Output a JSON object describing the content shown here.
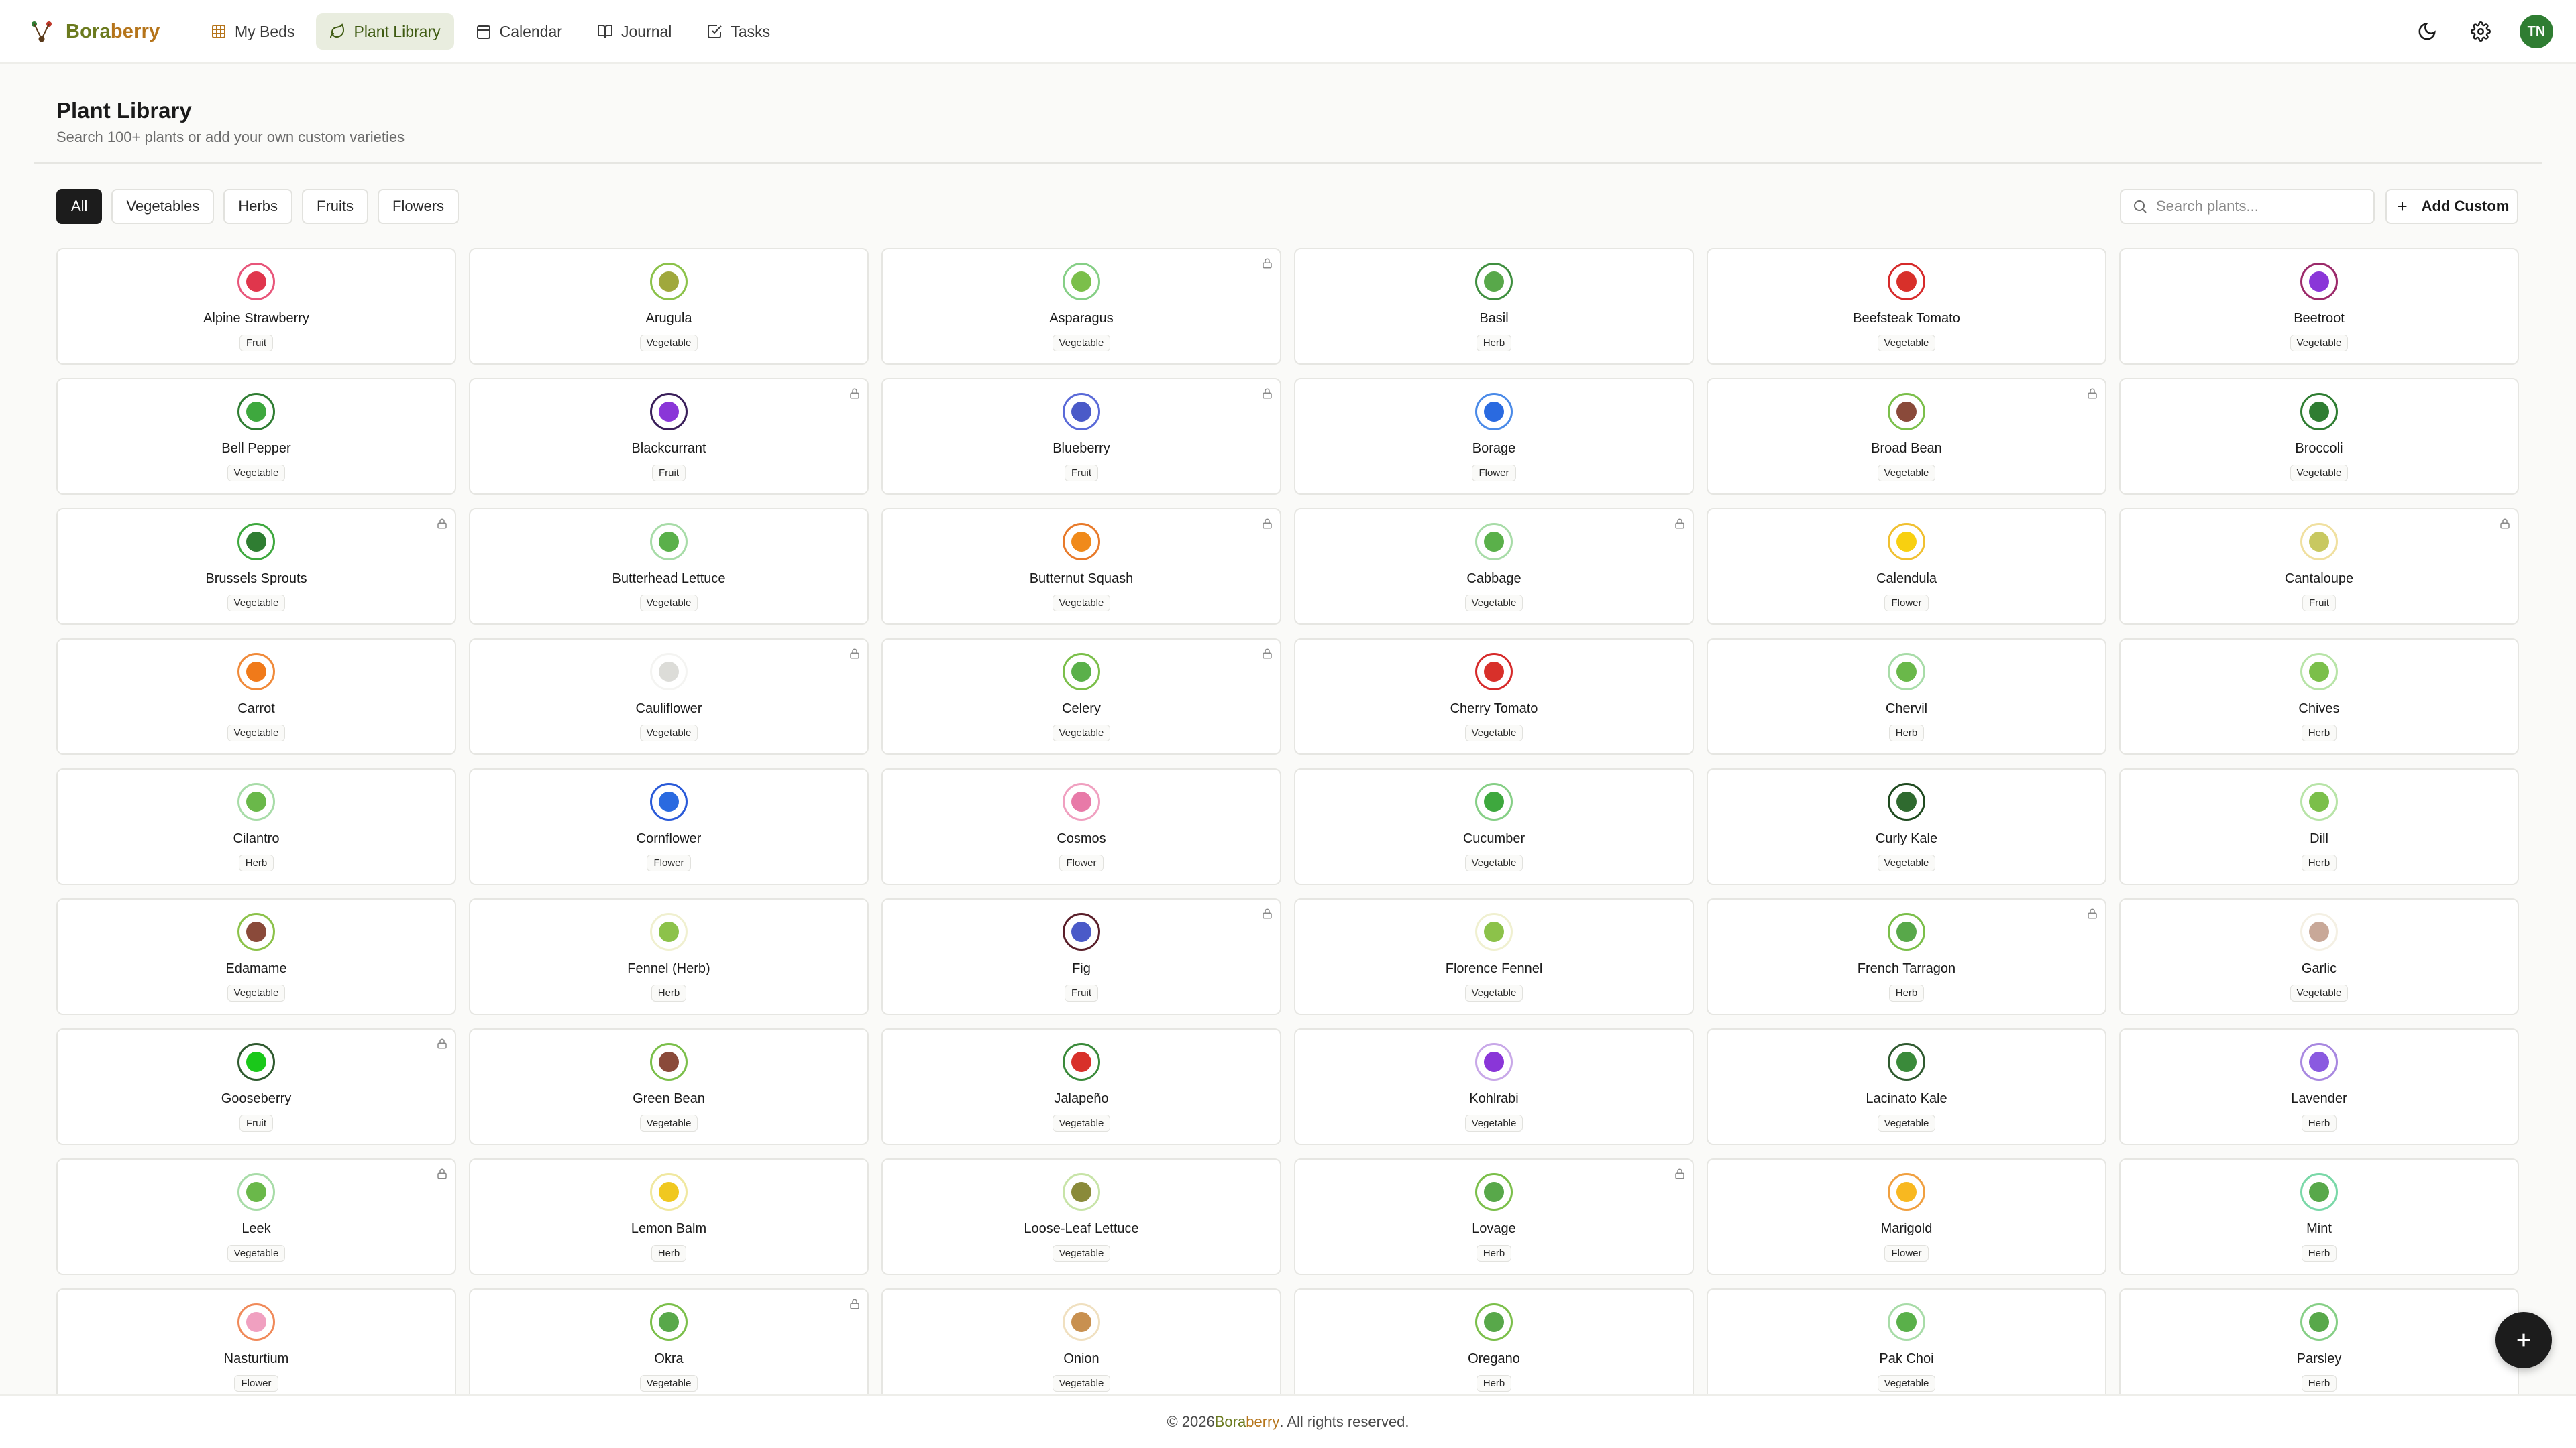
{
  "brand": {
    "name_part1": "Bora",
    "name_part2": "berry"
  },
  "nav": [
    {
      "label": "My Beds",
      "icon": "grid-icon",
      "active": false
    },
    {
      "label": "Plant Library",
      "icon": "leaf-icon",
      "active": true
    },
    {
      "label": "Calendar",
      "icon": "calendar-icon",
      "active": false
    },
    {
      "label": "Journal",
      "icon": "book-icon",
      "active": false
    },
    {
      "label": "Tasks",
      "icon": "checkbox-icon",
      "active": false
    }
  ],
  "user": {
    "initials": "TN"
  },
  "page": {
    "title": "Plant Library",
    "subtitle": "Search 100+ plants or add your own custom varieties"
  },
  "filters": [
    "All",
    "Vegetables",
    "Herbs",
    "Fruits",
    "Flowers"
  ],
  "active_filter": "All",
  "search": {
    "placeholder": "Search plants..."
  },
  "add_custom_label": "Add Custom",
  "plants": [
    {
      "name": "Alpine Strawberry",
      "type": "Fruit",
      "locked": false,
      "ring": "#e8567a",
      "fill": "#e0364c"
    },
    {
      "name": "Arugula",
      "type": "Vegetable",
      "locked": false,
      "ring": "#8cc24a",
      "fill": "#a0a83c"
    },
    {
      "name": "Asparagus",
      "type": "Vegetable",
      "locked": true,
      "ring": "#86cf86",
      "fill": "#7bbf4a"
    },
    {
      "name": "Basil",
      "type": "Herb",
      "locked": false,
      "ring": "#3f8f3f",
      "fill": "#58a84a"
    },
    {
      "name": "Beefsteak Tomato",
      "type": "Vegetable",
      "locked": false,
      "ring": "#d62a2a",
      "fill": "#d8302a"
    },
    {
      "name": "Beetroot",
      "type": "Vegetable",
      "locked": false,
      "ring": "#9c2a6a",
      "fill": "#8a36d8"
    },
    {
      "name": "Bell Pepper",
      "type": "Vegetable",
      "locked": false,
      "ring": "#2f7d32",
      "fill": "#3ea83e"
    },
    {
      "name": "Blackcurrant",
      "type": "Fruit",
      "locked": true,
      "ring": "#3a1f5a",
      "fill": "#8a36d8"
    },
    {
      "name": "Blueberry",
      "type": "Fruit",
      "locked": true,
      "ring": "#5a6ad8",
      "fill": "#4a5ac8"
    },
    {
      "name": "Borage",
      "type": "Flower",
      "locked": false,
      "ring": "#4a8ae8",
      "fill": "#2a6ae0"
    },
    {
      "name": "Broad Bean",
      "type": "Vegetable",
      "locked": true,
      "ring": "#7bbf4a",
      "fill": "#8a4a3a"
    },
    {
      "name": "Broccoli",
      "type": "Vegetable",
      "locked": false,
      "ring": "#2f7d32",
      "fill": "#2f7d32"
    },
    {
      "name": "Brussels Sprouts",
      "type": "Vegetable",
      "locked": true,
      "ring": "#3ea83e",
      "fill": "#2f7d32"
    },
    {
      "name": "Butterhead Lettuce",
      "type": "Vegetable",
      "locked": false,
      "ring": "#a8dca8",
      "fill": "#5ab04a"
    },
    {
      "name": "Butternut Squash",
      "type": "Vegetable",
      "locked": true,
      "ring": "#e87a2a",
      "fill": "#f08a1a"
    },
    {
      "name": "Cabbage",
      "type": "Vegetable",
      "locked": true,
      "ring": "#a8dca8",
      "fill": "#5ab04a"
    },
    {
      "name": "Calendula",
      "type": "Flower",
      "locked": false,
      "ring": "#f0c030",
      "fill": "#f8d010"
    },
    {
      "name": "Cantaloupe",
      "type": "Fruit",
      "locked": true,
      "ring": "#f0e0a0",
      "fill": "#c8c860"
    },
    {
      "name": "Carrot",
      "type": "Vegetable",
      "locked": false,
      "ring": "#f08a3a",
      "fill": "#f07a1a"
    },
    {
      "name": "Cauliflower",
      "type": "Vegetable",
      "locked": true,
      "ring": "#f4f4f2",
      "fill": "#dcdcd8"
    },
    {
      "name": "Celery",
      "type": "Vegetable",
      "locked": true,
      "ring": "#7bbf4a",
      "fill": "#5ab04a"
    },
    {
      "name": "Cherry Tomato",
      "type": "Vegetable",
      "locked": false,
      "ring": "#d62a2a",
      "fill": "#d8302a"
    },
    {
      "name": "Chervil",
      "type": "Herb",
      "locked": false,
      "ring": "#a8dca8",
      "fill": "#6ab84a"
    },
    {
      "name": "Chives",
      "type": "Herb",
      "locked": false,
      "ring": "#b8e4a8",
      "fill": "#7bbf4a"
    },
    {
      "name": "Cilantro",
      "type": "Herb",
      "locked": false,
      "ring": "#a8dca8",
      "fill": "#6ab84a"
    },
    {
      "name": "Cornflower",
      "type": "Flower",
      "locked": false,
      "ring": "#2a5ad8",
      "fill": "#2a6ae0"
    },
    {
      "name": "Cosmos",
      "type": "Flower",
      "locked": false,
      "ring": "#f0a0c0",
      "fill": "#e87aa8"
    },
    {
      "name": "Cucumber",
      "type": "Vegetable",
      "locked": false,
      "ring": "#86cf86",
      "fill": "#3ea83e"
    },
    {
      "name": "Curly Kale",
      "type": "Vegetable",
      "locked": false,
      "ring": "#1f4a1f",
      "fill": "#2f6a2f"
    },
    {
      "name": "Dill",
      "type": "Herb",
      "locked": false,
      "ring": "#b8e4a8",
      "fill": "#7bbf4a"
    },
    {
      "name": "Edamame",
      "type": "Vegetable",
      "locked": false,
      "ring": "#8cc24a",
      "fill": "#8a4a3a"
    },
    {
      "name": "Fennel (Herb)",
      "type": "Herb",
      "locked": false,
      "ring": "#f0f0d0",
      "fill": "#8cc24a"
    },
    {
      "name": "Fig",
      "type": "Fruit",
      "locked": true,
      "ring": "#5a1f2a",
      "fill": "#4a5ac8"
    },
    {
      "name": "Florence Fennel",
      "type": "Vegetable",
      "locked": false,
      "ring": "#f0f0d0",
      "fill": "#8cc24a"
    },
    {
      "name": "French Tarragon",
      "type": "Herb",
      "locked": true,
      "ring": "#7bbf4a",
      "fill": "#58a84a"
    },
    {
      "name": "Garlic",
      "type": "Vegetable",
      "locked": false,
      "ring": "#f4f0e4",
      "fill": "#c8a898"
    },
    {
      "name": "Gooseberry",
      "type": "Fruit",
      "locked": true,
      "ring": "#2f5a2f",
      "fill": "#1ac81a"
    },
    {
      "name": "Green Bean",
      "type": "Vegetable",
      "locked": false,
      "ring": "#7bbf4a",
      "fill": "#8a4a3a"
    },
    {
      "name": "Jalapeño",
      "type": "Vegetable",
      "locked": false,
      "ring": "#3a8a3a",
      "fill": "#d8302a"
    },
    {
      "name": "Kohlrabi",
      "type": "Vegetable",
      "locked": false,
      "ring": "#c8a8e8",
      "fill": "#8a36d8"
    },
    {
      "name": "Lacinato Kale",
      "type": "Vegetable",
      "locked": false,
      "ring": "#2f5a2f",
      "fill": "#3a8a3a"
    },
    {
      "name": "Lavender",
      "type": "Herb",
      "locked": false,
      "ring": "#a888e0",
      "fill": "#8a5ae0"
    },
    {
      "name": "Leek",
      "type": "Vegetable",
      "locked": true,
      "ring": "#a8dca8",
      "fill": "#6ab84a"
    },
    {
      "name": "Lemon Balm",
      "type": "Herb",
      "locked": false,
      "ring": "#f0e8a0",
      "fill": "#f0c820"
    },
    {
      "name": "Loose-Leaf Lettuce",
      "type": "Vegetable",
      "locked": false,
      "ring": "#c8e4a8",
      "fill": "#8a8a3a"
    },
    {
      "name": "Lovage",
      "type": "Herb",
      "locked": true,
      "ring": "#7bbf4a",
      "fill": "#58a84a"
    },
    {
      "name": "Marigold",
      "type": "Flower",
      "locked": false,
      "ring": "#f0a040",
      "fill": "#f8b820"
    },
    {
      "name": "Mint",
      "type": "Herb",
      "locked": false,
      "ring": "#7ad8a8",
      "fill": "#58a84a"
    },
    {
      "name": "Nasturtium",
      "type": "Flower",
      "locked": false,
      "ring": "#f08a5a",
      "fill": "#f0a0c0"
    },
    {
      "name": "Okra",
      "type": "Vegetable",
      "locked": true,
      "ring": "#7bbf4a",
      "fill": "#58a84a"
    },
    {
      "name": "Onion",
      "type": "Vegetable",
      "locked": false,
      "ring": "#f0e0c0",
      "fill": "#c89050"
    },
    {
      "name": "Oregano",
      "type": "Herb",
      "locked": false,
      "ring": "#7bbf4a",
      "fill": "#58a84a"
    },
    {
      "name": "Pak Choi",
      "type": "Vegetable",
      "locked": false,
      "ring": "#a8dca8",
      "fill": "#5ab04a"
    },
    {
      "name": "Parsley",
      "type": "Herb",
      "locked": false,
      "ring": "#86cf86",
      "fill": "#58a84a"
    }
  ],
  "footer": {
    "prefix": "© 2026 ",
    "brand_part1": "Bora",
    "brand_part2": "berry",
    "suffix": ". All rights reserved."
  }
}
